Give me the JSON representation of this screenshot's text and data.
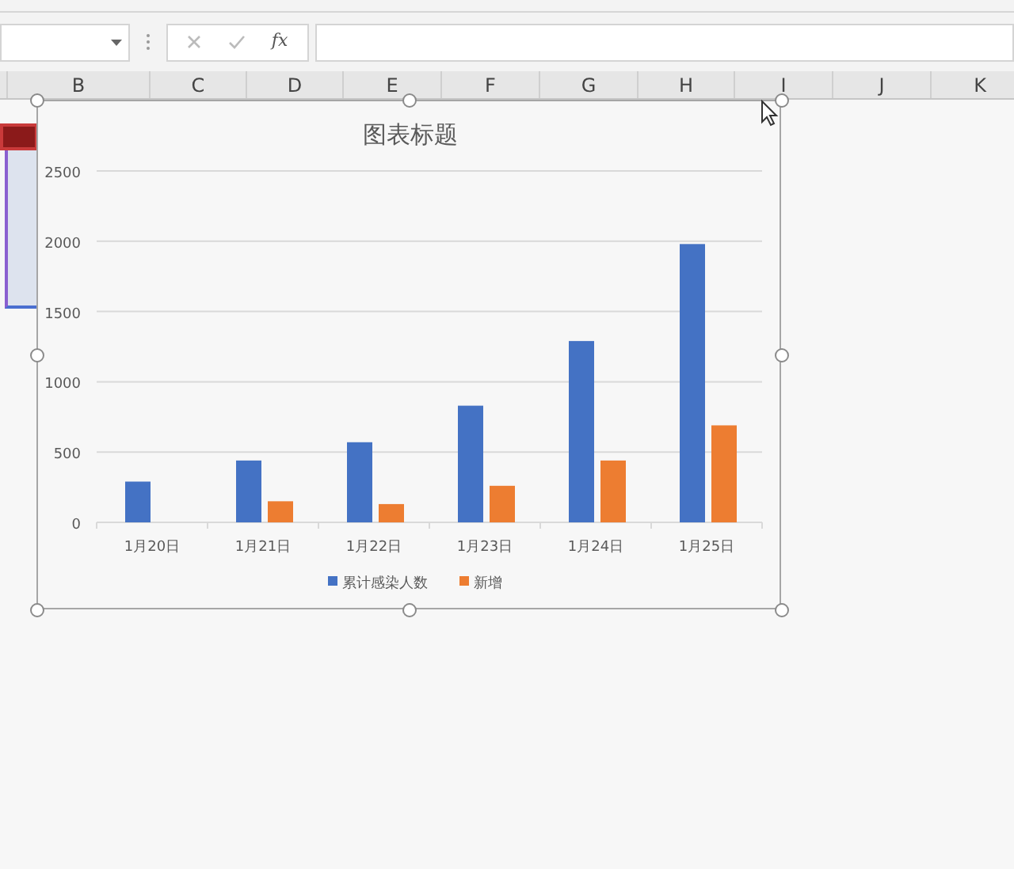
{
  "formula_bar": {
    "fx": "fx"
  },
  "columns": [
    {
      "label": "B"
    },
    {
      "label": "C"
    },
    {
      "label": "D"
    },
    {
      "label": "E"
    },
    {
      "label": "F"
    },
    {
      "label": "G"
    },
    {
      "label": "H"
    },
    {
      "label": "I"
    },
    {
      "label": "J"
    },
    {
      "label": "K"
    }
  ],
  "chart": {
    "chart_data": {
      "type": "bar",
      "title": "图表标题",
      "categories": [
        "1月20日",
        "1月21日",
        "1月22日",
        "1月23日",
        "1月24日",
        "1月25日"
      ],
      "series": [
        {
          "name": "累计感染人数",
          "color": "#4472c4",
          "values": [
            290,
            440,
            570,
            830,
            1290,
            1980
          ]
        },
        {
          "name": "新增",
          "color": "#ed7d31",
          "values": [
            0,
            150,
            130,
            260,
            440,
            690
          ]
        }
      ],
      "ylim": [
        0,
        2500
      ],
      "yticks": [
        0,
        500,
        1000,
        1500,
        2000,
        2500
      ],
      "grid": true,
      "legend": "bottom"
    }
  }
}
